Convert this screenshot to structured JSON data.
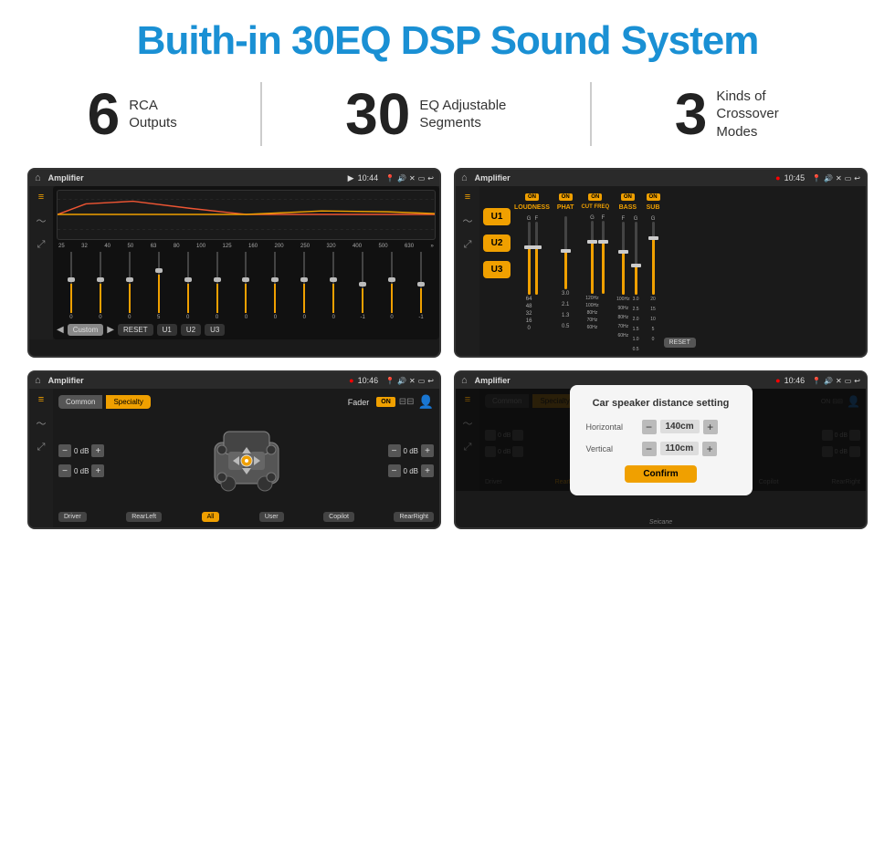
{
  "title": "Buith-in 30EQ DSP Sound System",
  "stats": [
    {
      "number": "6",
      "label": "RCA\nOutputs"
    },
    {
      "number": "30",
      "label": "EQ Adjustable\nSegments"
    },
    {
      "number": "3",
      "label": "Kinds of\nCrossover Modes"
    }
  ],
  "screens": [
    {
      "id": "screen1",
      "statusbar": {
        "title": "Amplifier",
        "time": "10:44"
      },
      "type": "eq",
      "freqLabels": [
        "25",
        "32",
        "40",
        "50",
        "63",
        "80",
        "100",
        "125",
        "160",
        "200",
        "250",
        "320",
        "400",
        "500",
        "630"
      ],
      "sliderValues": [
        "0",
        "0",
        "0",
        "5",
        "0",
        "0",
        "0",
        "0",
        "0",
        "0",
        "-1",
        "0",
        "-1"
      ],
      "buttons": [
        "Custom",
        "RESET",
        "U1",
        "U2",
        "U3"
      ]
    },
    {
      "id": "screen2",
      "statusbar": {
        "title": "Amplifier",
        "time": "10:45"
      },
      "type": "amplifier",
      "uButtons": [
        "U1",
        "U2",
        "U3"
      ],
      "controls": [
        "LOUDNESS",
        "PHAT",
        "CUT FREQ",
        "BASS",
        "SUB"
      ],
      "resetLabel": "RESET"
    },
    {
      "id": "screen3",
      "statusbar": {
        "title": "Amplifier",
        "time": "10:46"
      },
      "type": "fader",
      "tabs": [
        "Common",
        "Specialty"
      ],
      "faderLabel": "Fader",
      "dbValues": [
        "0 dB",
        "0 dB",
        "0 dB",
        "0 dB"
      ],
      "navButtons": [
        "Driver",
        "RearLeft",
        "All",
        "User",
        "Copilot",
        "RearRight"
      ]
    },
    {
      "id": "screen4",
      "statusbar": {
        "title": "Amplifier",
        "time": "10:46"
      },
      "type": "dialog",
      "dialog": {
        "title": "Car speaker distance setting",
        "fields": [
          {
            "label": "Horizontal",
            "value": "140cm"
          },
          {
            "label": "Vertical",
            "value": "110cm"
          }
        ],
        "confirmLabel": "Confirm"
      }
    }
  ],
  "watermark": "Seicane"
}
